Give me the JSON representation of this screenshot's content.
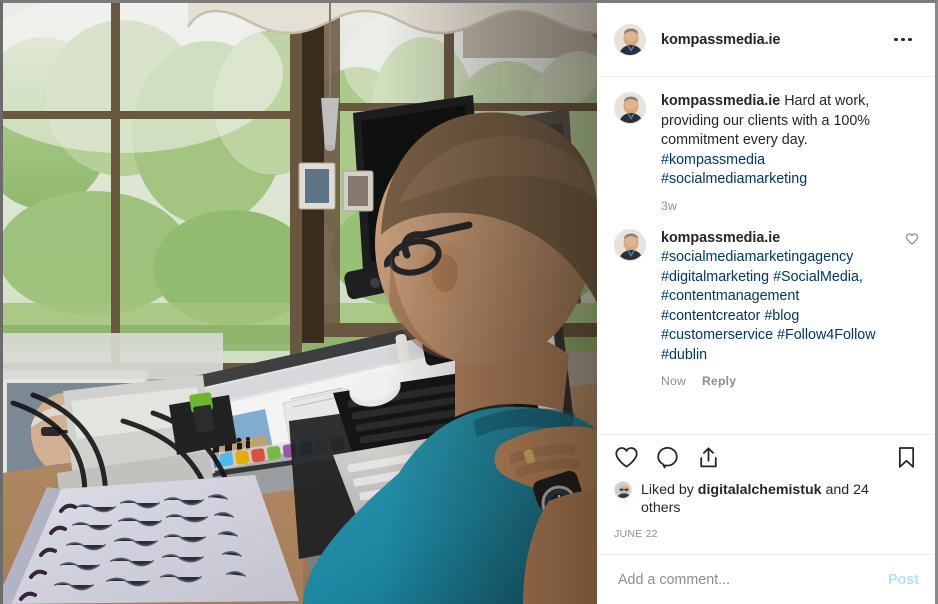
{
  "app": "instagram-post",
  "colors": {
    "text": "#262626",
    "muted": "#8e8e8e",
    "link": "#00376b",
    "post_disabled": "#b2dffc",
    "divider": "#efefef"
  },
  "header": {
    "username": "kompassmedia.ie",
    "avatar_alt": "kompassmedia.ie profile photo",
    "more_options": "more-options"
  },
  "photo": {
    "alt": "Man in teal polo shirt working at an iMac desk by a sunlit window, with a handwritten notebook in the foreground"
  },
  "caption": {
    "username": "kompassmedia.ie",
    "text": "Hard at work, providing our clients with a 100% commitment every day.",
    "hashtags": [
      "#kompassmedia",
      "#socialmediamarketing"
    ],
    "time": "3w"
  },
  "comments": [
    {
      "username": "kompassmedia.ie",
      "hashtags": [
        "#socialmediamarketingagency",
        "#digitalmarketing",
        "#SocialMedia,",
        "#contentmanagement",
        "#contentcreator",
        "#blog",
        "#customerservice",
        "#Follow4Follow",
        "#dublin"
      ],
      "time": "Now",
      "reply_label": "Reply",
      "like_icon": "heart-icon"
    }
  ],
  "actions": {
    "like": "heart-icon",
    "comment": "comment-bubble-icon",
    "share": "share-icon",
    "save": "bookmark-icon"
  },
  "likes": {
    "prefix": "Liked by",
    "username": "digitalalchemistuk",
    "suffix": "and 24 others",
    "count": 24
  },
  "date": "JUNE 22",
  "add_comment": {
    "placeholder": "Add a comment...",
    "value": "",
    "post_label": "Post"
  }
}
